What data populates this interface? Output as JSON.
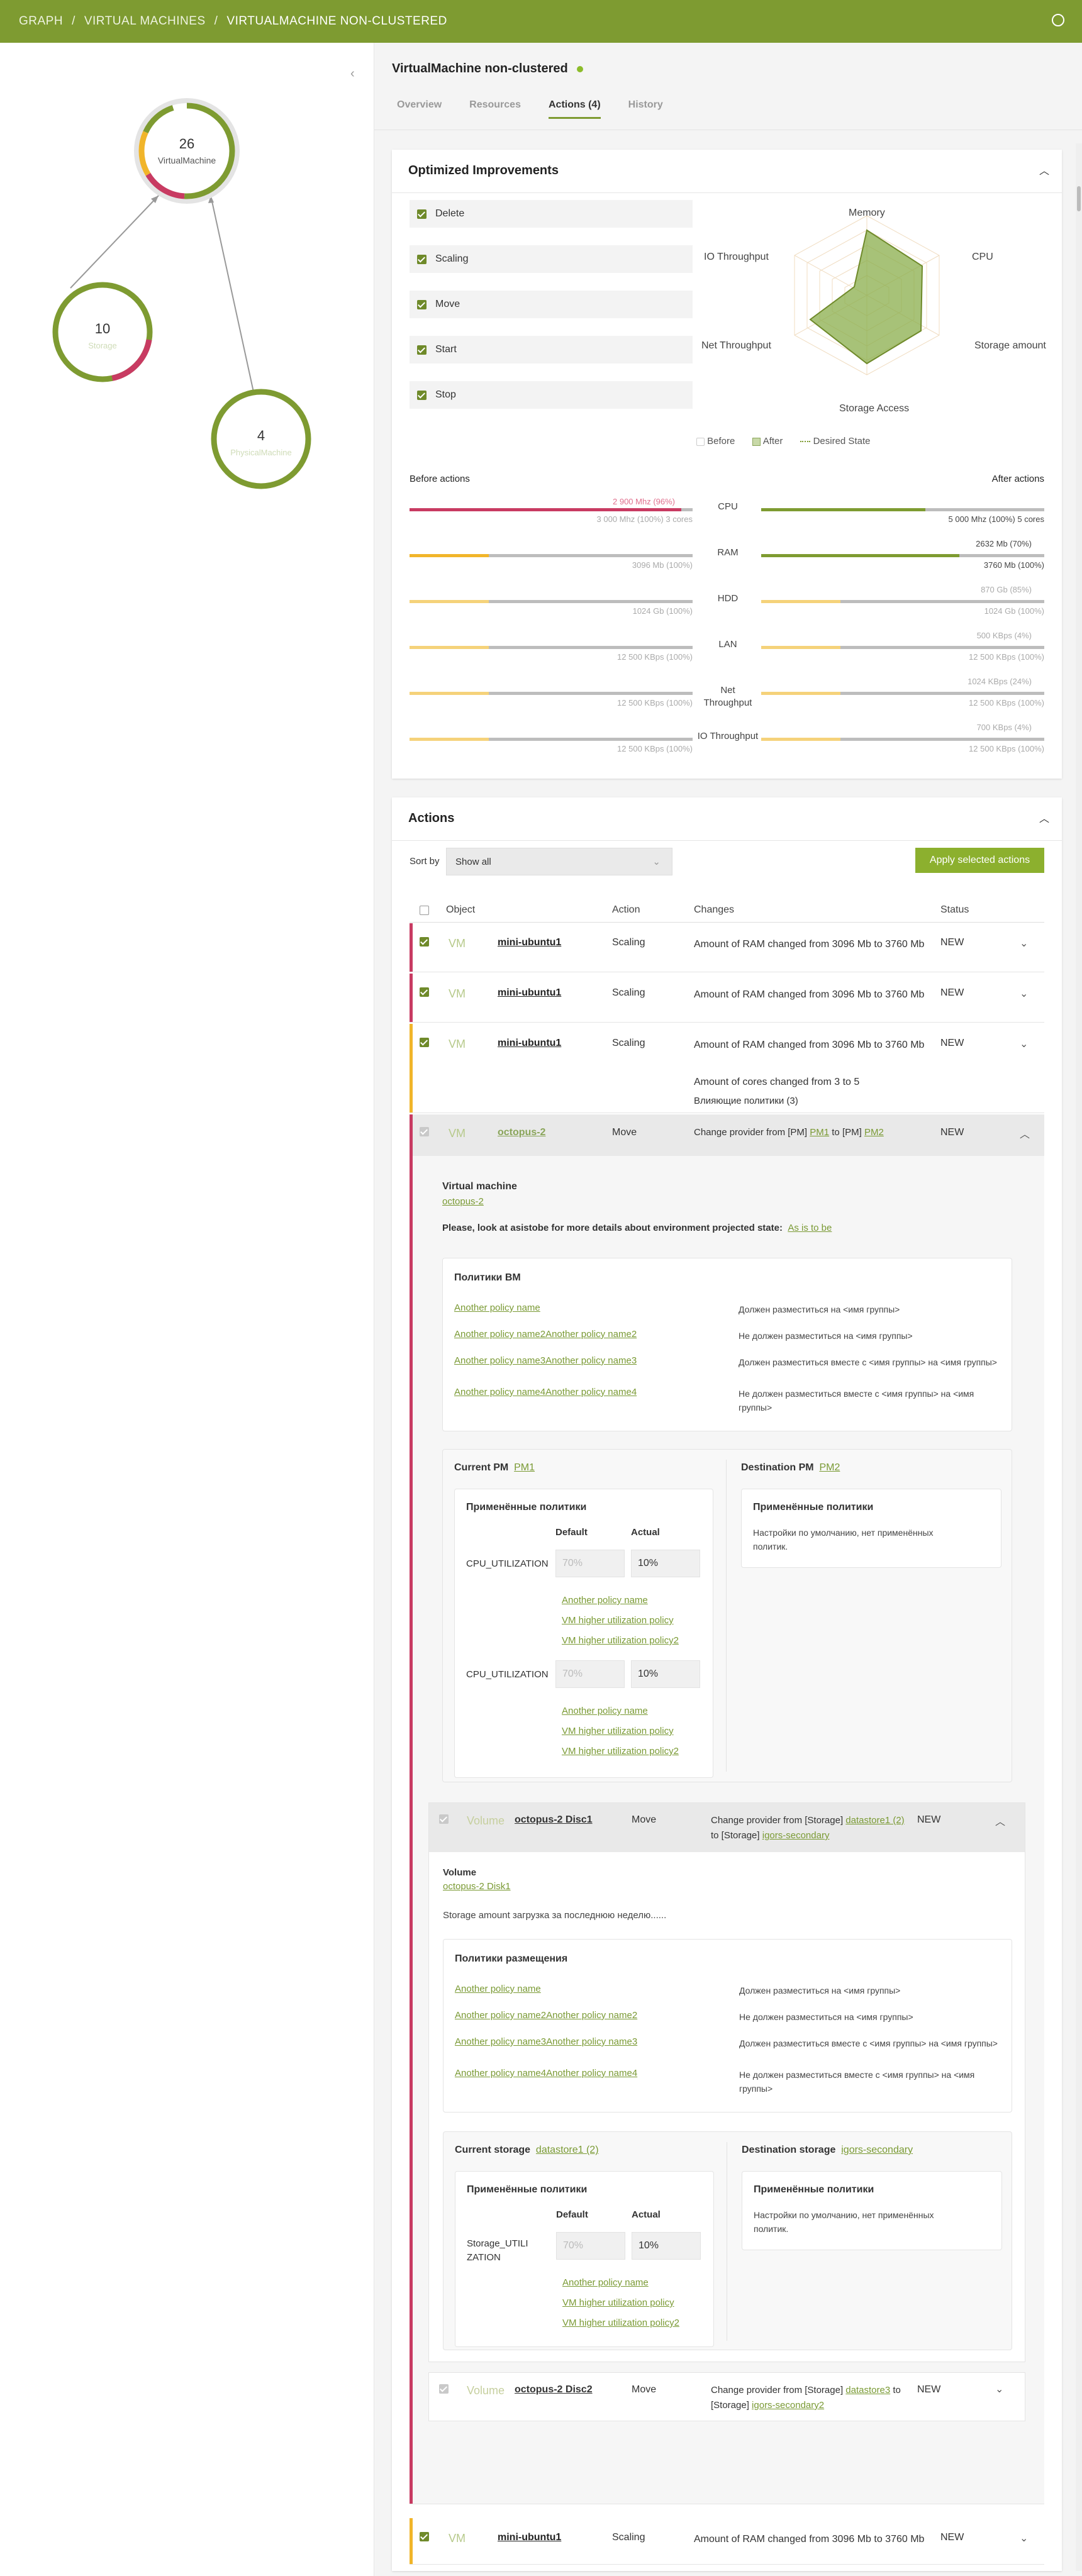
{
  "breadcrumb": {
    "items": [
      "GRAPH",
      "VIRTUAL MACHINES"
    ],
    "current": "VIRTUALMACHINE NON-CLUSTERED"
  },
  "graph": {
    "center": {
      "count": "26",
      "label": "VirtualMachine"
    },
    "left": {
      "count": "10",
      "label": "Storage"
    },
    "right": {
      "count": "4",
      "label": "PhysicalMachine"
    }
  },
  "page": {
    "title": "VirtualMachine non-clustered"
  },
  "tabs": [
    "Overview",
    "Resources",
    "Actions (4)",
    "History"
  ],
  "optimized": {
    "title": "Optimized Improvements",
    "options": [
      "Delete",
      "Scaling",
      "Move",
      "Start",
      "Stop"
    ],
    "radar": {
      "labels": [
        "Memory",
        "CPU",
        "Storage amount",
        "Storage Access",
        "Net Throughput",
        "IO Throughput"
      ]
    },
    "legend": [
      "Before",
      "After",
      "Desired State"
    ],
    "before_title": "Before actions",
    "after_title": "After actions",
    "metrics": [
      {
        "name": "CPU",
        "before_top": "2 900 Mhz (96%)",
        "before_bottom": "3 000 Mhz (100%) 3 cores",
        "after_top": "",
        "after_bottom": "5 000 Mhz (100%) 5 cores",
        "before_level": 0.96,
        "after_level": 0.58
      },
      {
        "name": "RAM",
        "before_top": "",
        "before_bottom": "3096 Mb (100%)",
        "after_top": "2632 Mb (70%)",
        "after_bottom": "3760 Mb (100%)",
        "before_level": 0.28,
        "after_level": 0.7
      },
      {
        "name": "HDD",
        "before_top": "",
        "before_bottom": "1024 Gb (100%)",
        "after_top": "870 Gb (85%)",
        "after_bottom": "1024 Gb (100%)",
        "before_level": 0.28,
        "after_level": 0.28
      },
      {
        "name": "LAN",
        "before_top": "",
        "before_bottom": "12 500 KBps (100%)",
        "after_top": "500 KBps (4%)",
        "after_bottom": "12 500 KBps (100%)",
        "before_level": 0.28,
        "after_level": 0.28
      },
      {
        "name": "Net Throughput",
        "before_top": "",
        "before_bottom": "12 500 KBps (100%)",
        "after_top": "1024 KBps (24%)",
        "after_bottom": "12 500 KBps (100%)",
        "before_level": 0.28,
        "after_level": 0.28
      },
      {
        "name": "IO Throughput",
        "before_top": "",
        "before_bottom": "12 500 KBps (100%)",
        "after_top": "700 KBps (4%)",
        "after_bottom": "12 500 KBps (100%)",
        "before_level": 0.28,
        "after_level": 0.28
      }
    ]
  },
  "actions": {
    "title": "Actions",
    "sort_label": "Sort by",
    "sort_value": "Show all",
    "apply_label": "Apply selected actions",
    "columns": [
      "Object",
      "Action",
      "Changes",
      "Status"
    ],
    "rows": [
      {
        "type": "VM",
        "name": "mini-ubuntu1",
        "action": "Scaling",
        "change": "Amount of RAM changed from 3096 Mb to 3760 Mb",
        "status": "NEW"
      },
      {
        "type": "VM",
        "name": "mini-ubuntu1",
        "action": "Scaling",
        "change": "Amount of RAM changed from 3096 Mb to 3760 Mb",
        "status": "NEW"
      },
      {
        "type": "VM",
        "name": "mini-ubuntu1",
        "action": "Scaling",
        "change": "Amount of RAM changed from 3096 Mb to 3760 Mb",
        "change2": "Amount of cores changed  from 3 to 5",
        "change3": "Влияющие политики (3)",
        "status": "NEW"
      },
      {
        "type": "VM",
        "name": "octopus-2",
        "action": "Move",
        "change_pre": "Change provider from [PM]",
        "change_from": "PM1",
        "change_mid": "to [PM]",
        "change_to": "PM2",
        "status": "NEW"
      }
    ],
    "detail": {
      "heading": "Virtual machine",
      "object_link": "octopus-2",
      "note": "Please, look at asistobe for more details about environment projected state:",
      "note_link": "As is to be",
      "policies_title": "Политики ВМ",
      "policies": [
        {
          "name": "Another policy name",
          "rule": "Должен разместиться на <имя группы>"
        },
        {
          "name": "Another policy name2Another policy name2",
          "rule": "Не должен разместиться на <имя группы>"
        },
        {
          "name": "Another policy name3Another policy name3",
          "rule": "Должен разместиться вместе с <имя группы> на <имя группы>"
        },
        {
          "name": "Another policy name4Another policy name4",
          "rule": "Не должен разместиться вместе с <имя группы> на <имя группы>"
        }
      ],
      "current_label": "Current PM",
      "current_link": "PM1",
      "dest_label": "Destination PM",
      "dest_link": "PM2",
      "applied_title": "Применённые политики",
      "col_default": "Default",
      "col_actual": "Actual",
      "metric_rows": [
        {
          "name": "CPU_UTILIZATION",
          "default": "70%",
          "actual": "10%",
          "links": [
            "Another policy name",
            "VM higher utilization policy",
            "VM higher utilization policy2"
          ]
        },
        {
          "name": "CPU_UTILIZATION",
          "default": "70%",
          "actual": "10%",
          "links": [
            "Another policy name",
            "VM higher utilization policy",
            "VM higher utilization policy2"
          ]
        }
      ],
      "dest_text": "Настройки по умолчанию, нет применённых политик."
    },
    "volume": {
      "type": "Volume",
      "name": "octopus-2 Disc1",
      "action": "Move",
      "change_pre": "Change provider from [Storage]",
      "change_from": "datastore1 (2)",
      "change_mid": "to [Storage]",
      "change_to": "igors-secondary",
      "status": "NEW",
      "heading": "Volume",
      "object_link": "octopus-2 Disk1",
      "note": "Storage amount загрузка за последнюю неделю......",
      "policies_title": "Политики размещения",
      "current_label": "Current storage",
      "current_link": "datastore1 (2)",
      "dest_label": "Destination storage",
      "dest_link": "igors-secondary",
      "metric_name": "Storage_UTILIZATION",
      "default": "70%",
      "actual": "10%",
      "links": [
        "Another policy name",
        "VM higher utilization policy",
        "VM higher utilization policy2"
      ]
    },
    "volume2": {
      "type": "Volume",
      "name": "octopus-2 Disc2",
      "action": "Move",
      "change_pre": "Change provider from [Storage]",
      "change_from": "datastore3",
      "change_mid": "to [Storage]",
      "change_to": "igors-secondary2",
      "status": "NEW"
    },
    "last_row": {
      "type": "VM",
      "name": "mini-ubuntu1",
      "action": "Scaling",
      "change": "Amount of RAM changed from 3096 Mb to 3760 Mb",
      "status": "NEW"
    }
  }
}
